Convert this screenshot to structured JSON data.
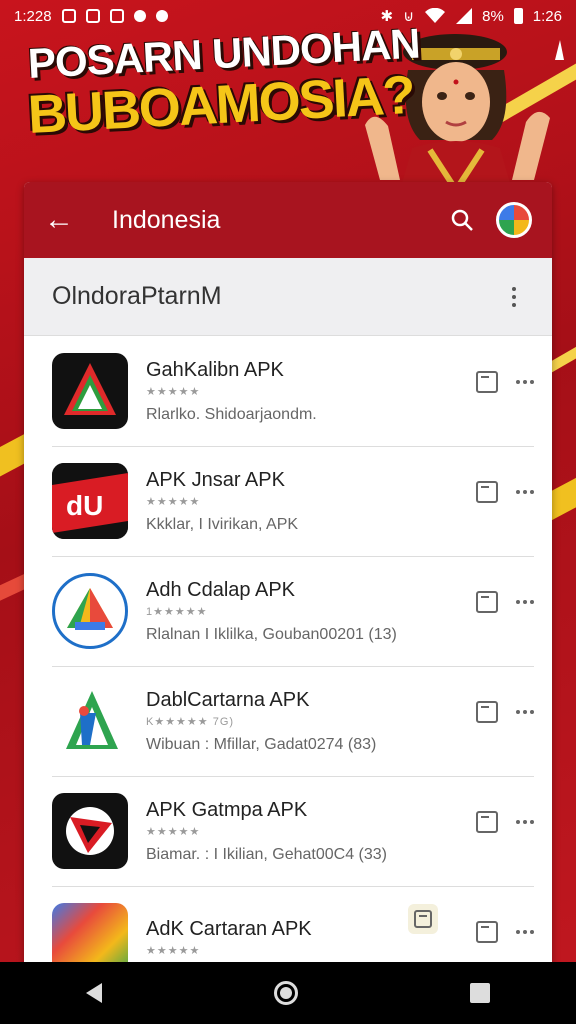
{
  "status": {
    "time_left": "1:228",
    "battery": "8%",
    "clock": "1:26"
  },
  "banner": {
    "line1": "POSARN UNDOHAN",
    "line2": "BUBOAMOSIA?"
  },
  "appbar": {
    "title": "Indonesia"
  },
  "subhead": {
    "title": "OlndoraPtarnM"
  },
  "apps": [
    {
      "name": "GahKalibn APK",
      "stars": "★★★★★",
      "meta": "Rlarlko.  Shidoarjaondm."
    },
    {
      "name": "APK Jnsar APK",
      "stars": "★★★★★",
      "meta": "Kkklar, I Ivirikan, APK"
    },
    {
      "name": "Adh Cdalap APK",
      "stars": "1★★★★★",
      "meta": "Rlalnan I Iklilka, Gouban00201 (13)"
    },
    {
      "name": "DablCartarna APK",
      "stars": "K★★★★★ 7G)",
      "meta": "Wibuan : Mfillar, Gadat0274  (83)"
    },
    {
      "name": "APK Gatmpa APK",
      "stars": "★★★★★",
      "meta": "Biamar. : I Ikilian, Gehat00C4 (33)"
    },
    {
      "name": "AdK Cartaran APK",
      "stars": "★★★★★",
      "meta": ""
    }
  ],
  "icons": {
    "back": "arrow-left-icon",
    "search": "search-icon",
    "more": "more-vert-icon",
    "calendar": "calendar-icon"
  },
  "colors": {
    "brand": "#a8141f",
    "accent": "#f5c518"
  }
}
